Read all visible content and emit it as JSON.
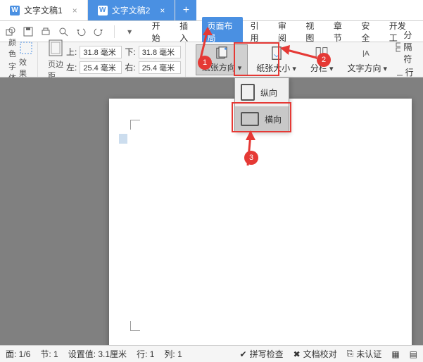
{
  "tabs": [
    {
      "label": "文字文稿1",
      "active": false
    },
    {
      "label": "文字文稿2",
      "active": true
    }
  ],
  "menus": {
    "items": [
      "开始",
      "插入",
      "页面布局",
      "引用",
      "审阅",
      "视图",
      "章节",
      "安全",
      "开发工"
    ],
    "active": "页面布局"
  },
  "ribbon": {
    "color_label": "颜色",
    "font_label": "字体",
    "effect_label": "效果",
    "margin_label": "页边距",
    "top_label": "上:",
    "top_val": "31.8 毫米",
    "left_label": "左:",
    "left_val": "25.4 毫米",
    "bottom_label": "下:",
    "bottom_val": "31.8 毫米",
    "right_label": "右:",
    "right_val": "25.4 毫米",
    "orient_label": "纸张方向",
    "size_label": "纸张大小",
    "columns_label": "分栏",
    "textdir_label": "文字方向",
    "linenum_label": "行号",
    "break_label": "分隔符"
  },
  "dropdown": {
    "portrait": "纵向",
    "landscape": "横向"
  },
  "badges": {
    "b1": "1",
    "b2": "2",
    "b3": "3"
  },
  "status": {
    "page": "面: 1/6",
    "section": "节: 1",
    "setval": "设置值: 3.1厘米",
    "row": "行: 1",
    "col": "列: 1",
    "spell": "拼写检查",
    "proof": "文档校对",
    "cert": "未认证"
  }
}
